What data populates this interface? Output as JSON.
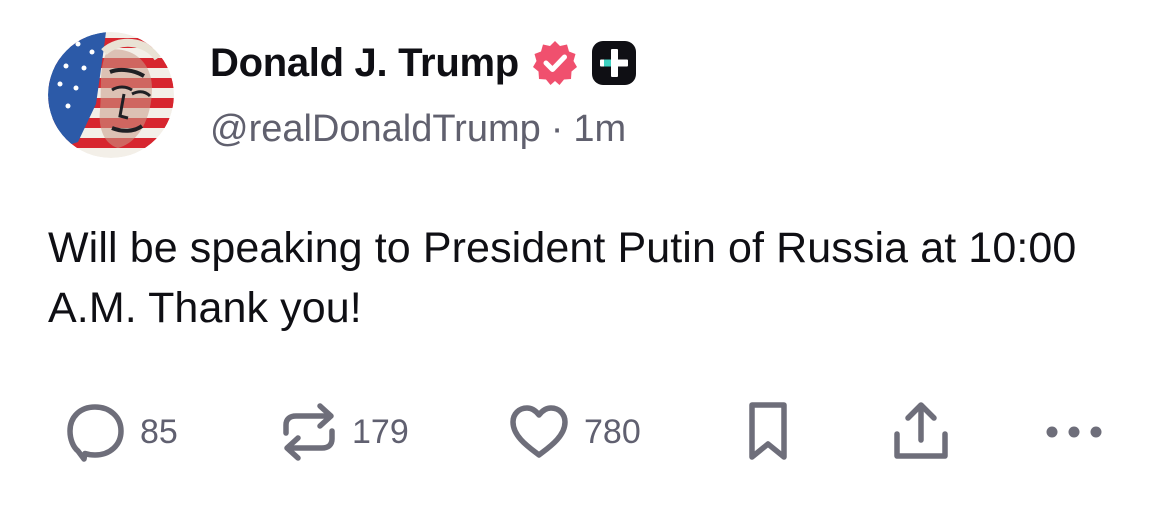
{
  "post": {
    "author": {
      "display_name": "Donald J. Trump",
      "handle": "@realDonaldTrump",
      "avatar_icon": "flag-portrait-avatar",
      "verified_icon": "verified-badge-icon",
      "plus_icon": "plus-badge-icon"
    },
    "separator": "·",
    "timestamp": "1m",
    "text": "Will be speaking to President Putin of Russia at 10:00 A.M. Thank you!",
    "actions": {
      "reply_count": "85",
      "repost_count": "179",
      "like_count": "780"
    }
  },
  "colors": {
    "text": "#0f0f14",
    "muted": "#60606e",
    "icon": "#6e6e7a",
    "verified": "#f0506e",
    "plus_badge": "#0f0f14",
    "plus_accent": "#3ed1c0"
  }
}
